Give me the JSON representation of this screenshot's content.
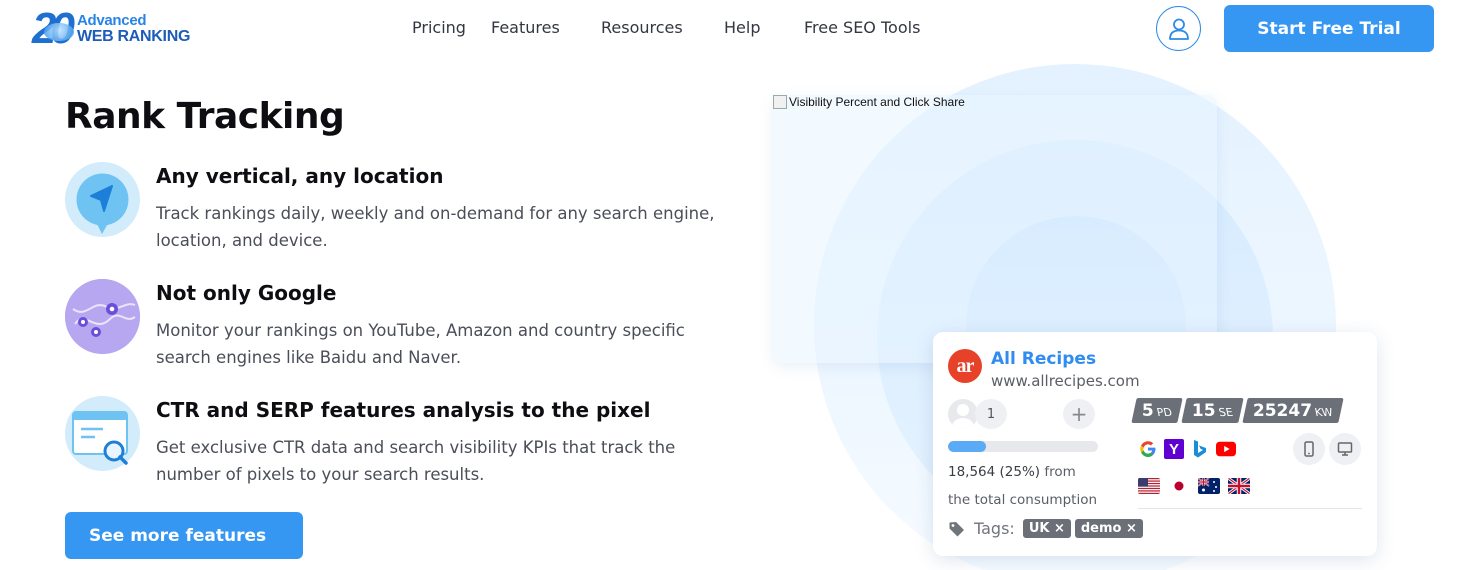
{
  "header": {
    "logo": {
      "number": "20",
      "line1": "Advanced",
      "line2": "WEB RANKING"
    },
    "nav": [
      "Pricing",
      "Features",
      "Resources",
      "Help",
      "Free SEO Tools"
    ],
    "user_icon": "user-icon",
    "cta_label": "Start Free Trial"
  },
  "main": {
    "title": "Rank Tracking",
    "features": [
      {
        "icon": "location-arrow-icon",
        "title": "Any vertical, any location",
        "text": "Track rankings daily, weekly and on-demand for any search engine, location, and device."
      },
      {
        "icon": "map-pins-icon",
        "title": "Not only Google",
        "text": "Monitor your rankings on YouTube, Amazon and country specific search engines like Baidu and Naver."
      },
      {
        "icon": "serp-analysis-icon",
        "title": "CTR and SERP features analysis to the pixel",
        "text": "Get exclusive CTR data and search visibility KPIs that track the number of pixels to your search results."
      }
    ],
    "more_label": "See more features"
  },
  "visual": {
    "image_alt": "Visibility Percent and Click Share",
    "card": {
      "logo_text": "ar",
      "site_name": "All Recipes",
      "site_url": "www.allrecipes.com",
      "user_count": "1",
      "plus": "+",
      "usage_fraction": 0.25,
      "usage_value": "18,564 (25%)",
      "usage_from": "from",
      "usage_rest": "the total consumption",
      "stats": [
        {
          "value": "5",
          "unit": "PD"
        },
        {
          "value": "15",
          "unit": "SE"
        },
        {
          "value": "25247",
          "unit": "KW"
        }
      ],
      "engines": [
        "google-icon",
        "yahoo-icon",
        "bing-icon",
        "youtube-icon"
      ],
      "devices": [
        "mobile-icon",
        "desktop-icon"
      ],
      "flags": [
        "us-flag-icon",
        "japan-flag-icon",
        "australia-flag-icon",
        "uk-flag-icon"
      ],
      "tags_label": "Tags:",
      "tags": [
        "UK ×",
        "demo ×"
      ]
    }
  },
  "colors": {
    "accent": "#3597f2",
    "brand_blue": "#2f8cf0",
    "tag_gray": "#6b7078",
    "allrecipes_red": "#e8412a"
  }
}
